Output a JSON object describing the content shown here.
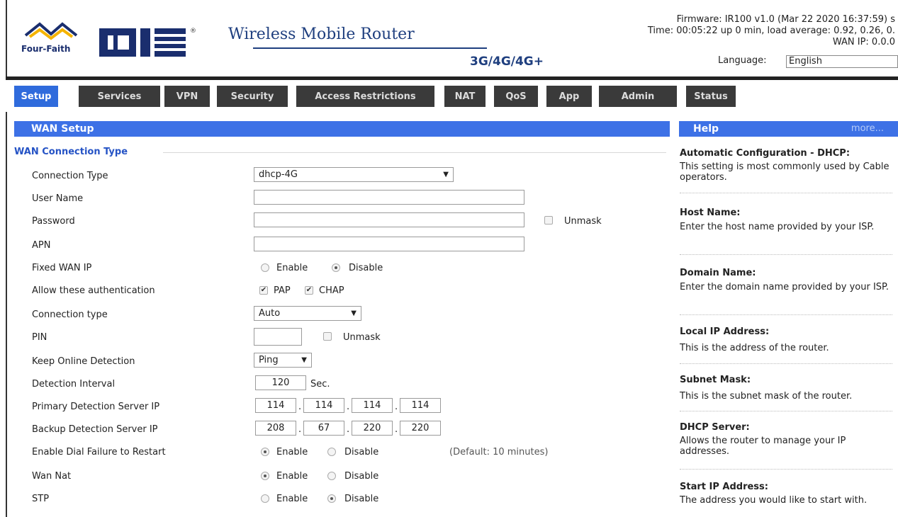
{
  "header": {
    "logo_brand": "Four-Faith",
    "logo_cn": "四信",
    "title": "Wireless Mobile Router",
    "subtitle": "3G/4G/4G+",
    "firmware": "Firmware: IR100 v1.0 (Mar 22 2020 16:37:59) s",
    "time": "Time: 00:05:22 up 0 min, load average: 0.92, 0.26, 0.",
    "wan_ip": "WAN IP: 0.0.0",
    "language_label": "Language:",
    "language_value": "English"
  },
  "tabs": [
    "Setup",
    "Services",
    "VPN",
    "Security",
    "Access Restrictions",
    "NAT",
    "QoS",
    "App",
    "Admin",
    "Status"
  ],
  "wan": {
    "header": "WAN Setup",
    "legend": "WAN Connection Type",
    "connection_type_label": "Connection Type",
    "connection_type_value": "dhcp-4G",
    "username_label": "User Name",
    "username_value": "",
    "password_label": "Password",
    "password_value": "",
    "unmask": "Unmask",
    "apn_label": "APN",
    "apn_value": "",
    "fixed_ip_label": "Fixed WAN IP",
    "enable": "Enable",
    "disable": "Disable",
    "auth_label": "Allow these authentication",
    "pap": "PAP",
    "chap": "CHAP",
    "conn_type2_label": "Connection type",
    "conn_type2_value": "Auto",
    "pin_label": "PIN",
    "pin_value": "",
    "keep_online_label": "Keep Online Detection",
    "keep_online_value": "Ping",
    "interval_label": "Detection Interval",
    "interval_value": "120",
    "interval_unit": "Sec.",
    "primary_label": "Primary Detection Server IP",
    "primary_ip": [
      "114",
      "114",
      "114",
      "114"
    ],
    "backup_label": "Backup Detection Server IP",
    "backup_ip": [
      "208",
      "67",
      "220",
      "220"
    ],
    "dial_fail_label": "Enable Dial Failure to Restart",
    "dial_fail_default": "(Default: 10 minutes)",
    "wan_nat_label": "Wan Nat",
    "stp_label": "STP"
  },
  "help": {
    "header": "Help",
    "more": "more...",
    "items": [
      {
        "title": "Automatic Configuration - DHCP:",
        "text": "This setting is most commonly used by Cable operators."
      },
      {
        "title": "Host Name:",
        "text": "Enter the host name provided by your ISP."
      },
      {
        "title": "Domain Name:",
        "text": "Enter the domain name provided by your ISP."
      },
      {
        "title": "Local IP Address:",
        "text": "This is the address of the router."
      },
      {
        "title": "Subnet Mask:",
        "text": "This is the subnet mask of the router."
      },
      {
        "title": "DHCP Server:",
        "text": "Allows the router to manage your IP addresses."
      },
      {
        "title": "Start IP Address:",
        "text": "The address you would like to start with."
      }
    ]
  }
}
